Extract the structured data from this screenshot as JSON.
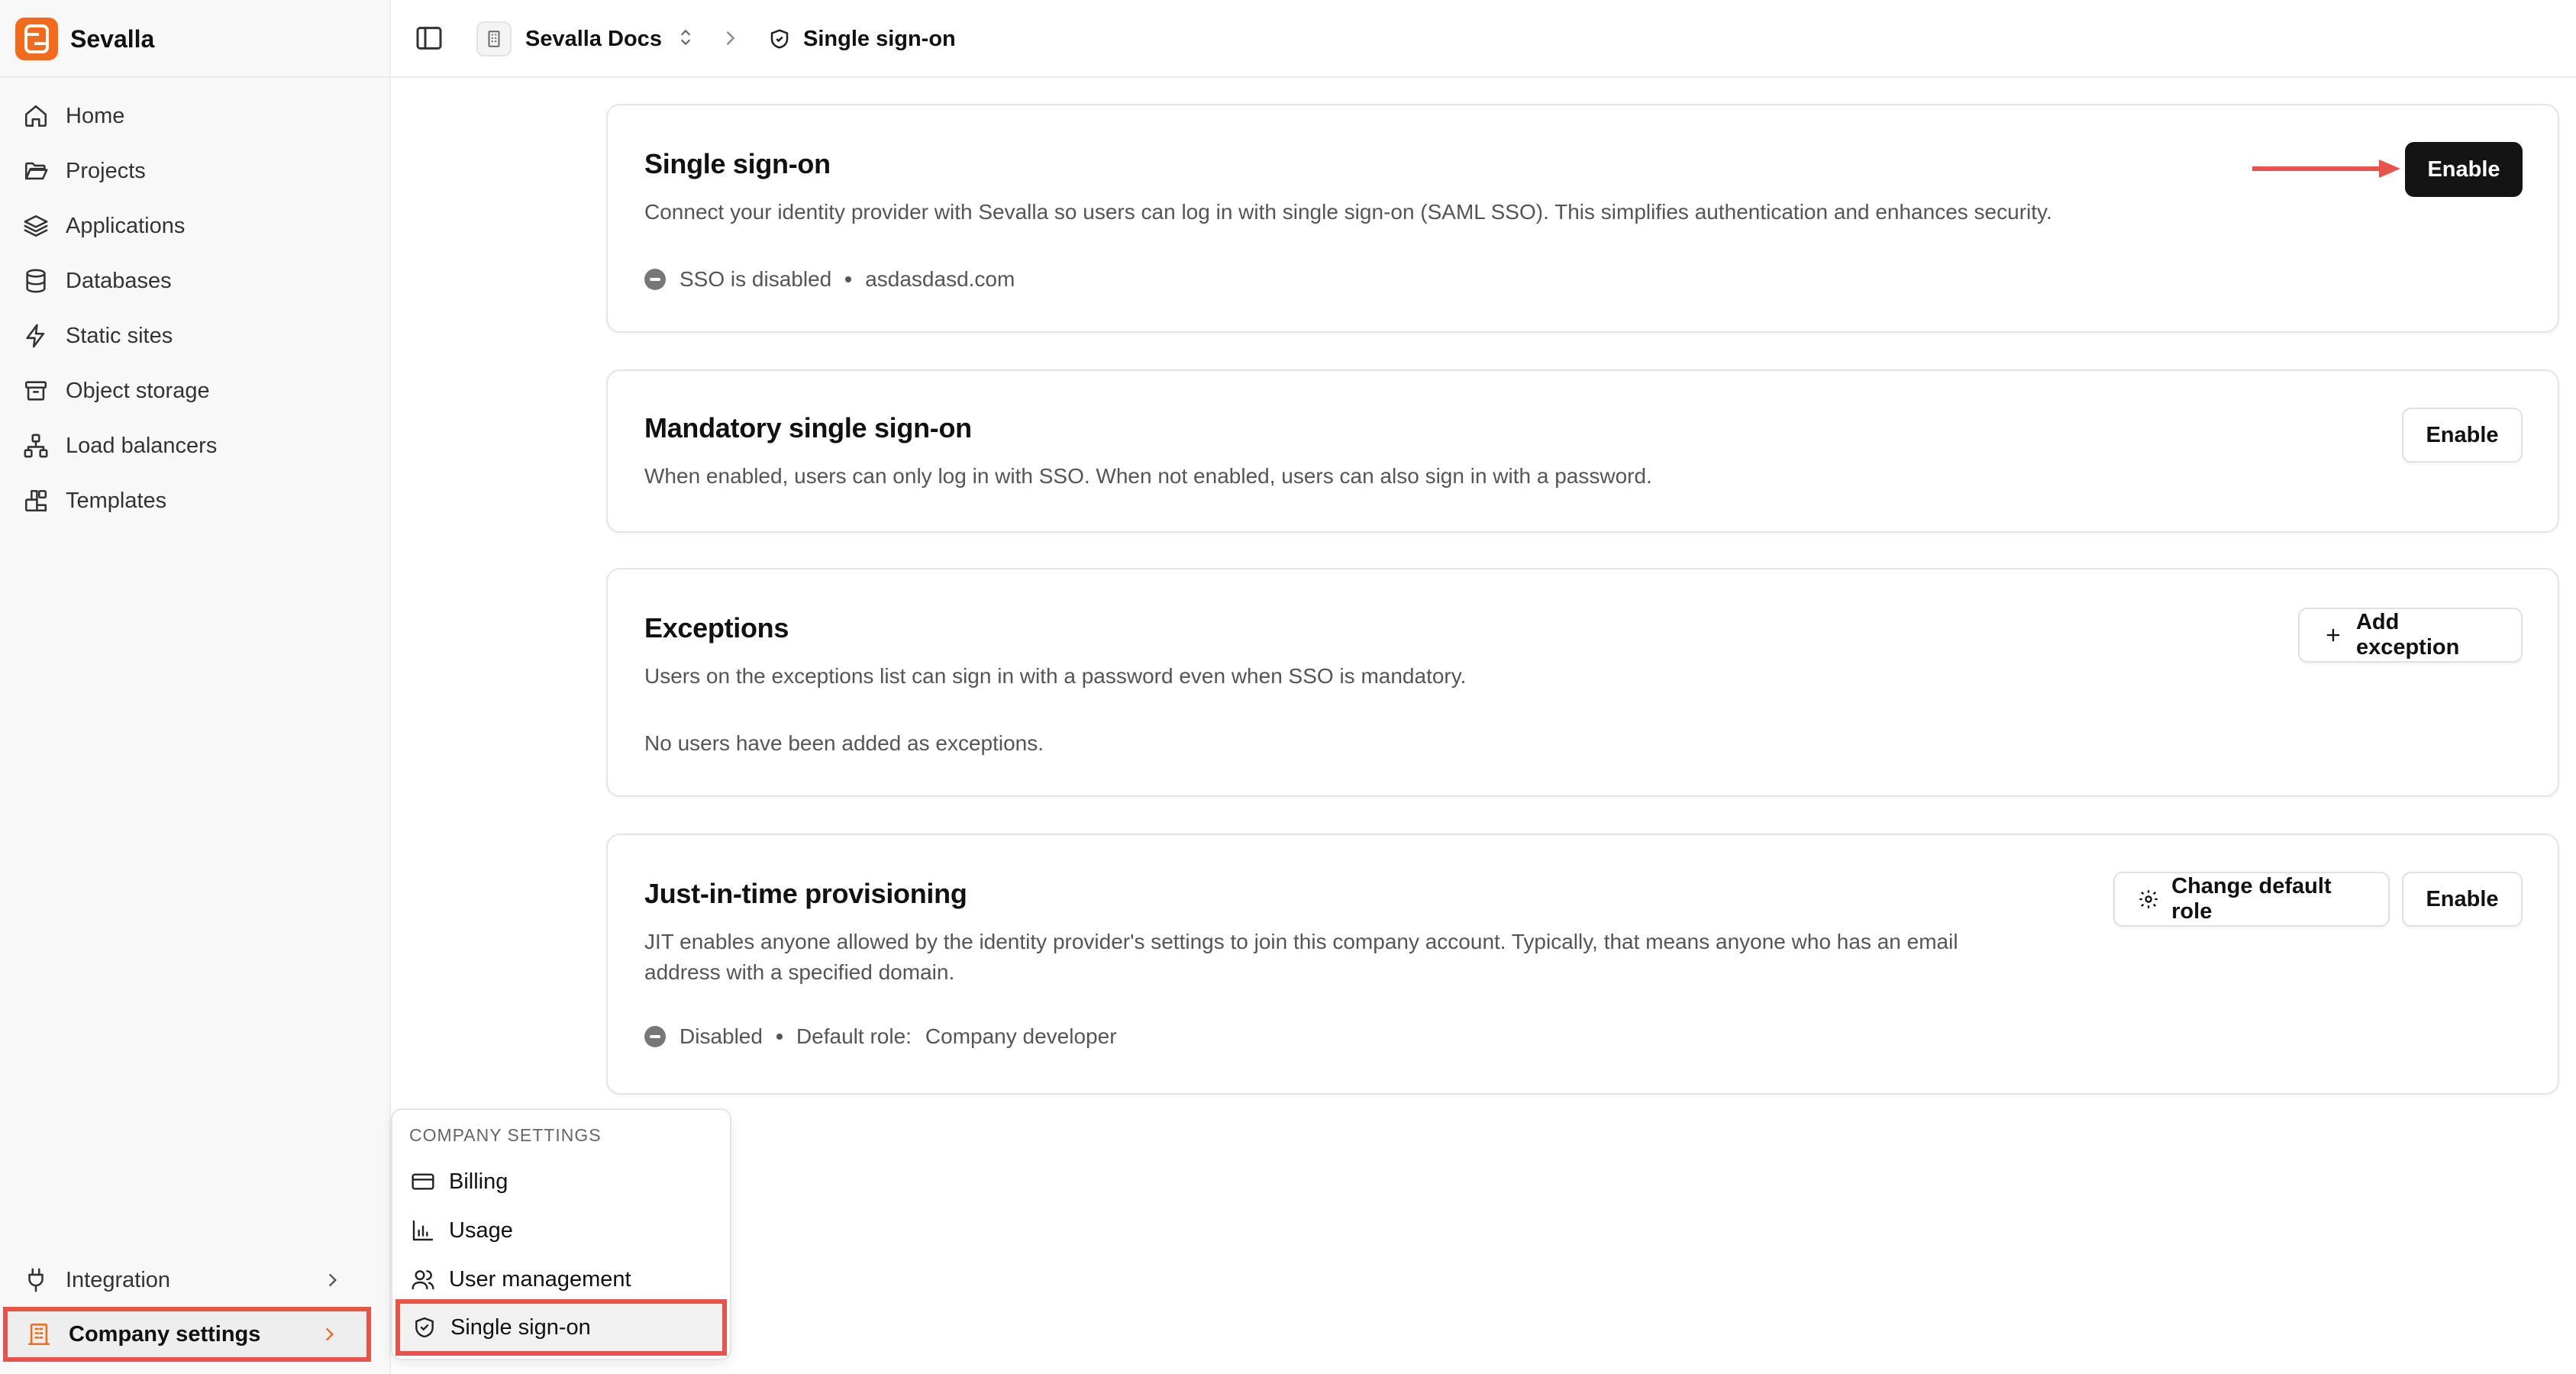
{
  "app": {
    "name": "Sevalla",
    "accent": "#f26a1b",
    "highlight": "#e8544a"
  },
  "sidebar": {
    "items": [
      {
        "label": "Home",
        "icon": "home-icon"
      },
      {
        "label": "Projects",
        "icon": "folder-icon"
      },
      {
        "label": "Applications",
        "icon": "layers-icon"
      },
      {
        "label": "Databases",
        "icon": "database-icon"
      },
      {
        "label": "Static sites",
        "icon": "bolt-icon"
      },
      {
        "label": "Object storage",
        "icon": "archive-icon"
      },
      {
        "label": "Load balancers",
        "icon": "network-icon"
      },
      {
        "label": "Templates",
        "icon": "blocks-icon"
      }
    ],
    "integration_label": "Integration",
    "company_settings_label": "Company settings"
  },
  "topbar": {
    "org_name": "Sevalla Docs",
    "crumb": "Single sign-on"
  },
  "cards": {
    "sso": {
      "title": "Single sign-on",
      "description": "Connect your identity provider with Sevalla so users can log in with single sign-on (SAML SSO). This simplifies authentication and enhances security.",
      "status": "SSO is disabled",
      "domain": "asdasdasd.com",
      "button": "Enable"
    },
    "mandatory": {
      "title": "Mandatory single sign-on",
      "description": "When enabled, users can only log in with SSO. When not enabled, users can also sign in with a password.",
      "button": "Enable"
    },
    "exceptions": {
      "title": "Exceptions",
      "description": "Users on the exceptions list can sign in with a password even when SSO is mandatory.",
      "empty": "No users have been added as exceptions.",
      "button": "Add exception"
    },
    "jit": {
      "title": "Just-in-time provisioning",
      "description_line1": "JIT enables anyone allowed by the identity provider's settings to join this company account. Typically, that means anyone who has an email",
      "description_line2": "address with a specified domain.",
      "status": "Disabled",
      "role_label": "Default role:",
      "role_value": "Company developer",
      "role_button": "Change default role",
      "button": "Enable"
    }
  },
  "menu": {
    "heading": "COMPANY SETTINGS",
    "items": [
      {
        "label": "Billing",
        "icon": "credit-card-icon"
      },
      {
        "label": "Usage",
        "icon": "bar-chart-icon"
      },
      {
        "label": "User management",
        "icon": "users-icon"
      },
      {
        "label": "Single sign-on",
        "icon": "shield-icon"
      }
    ]
  }
}
